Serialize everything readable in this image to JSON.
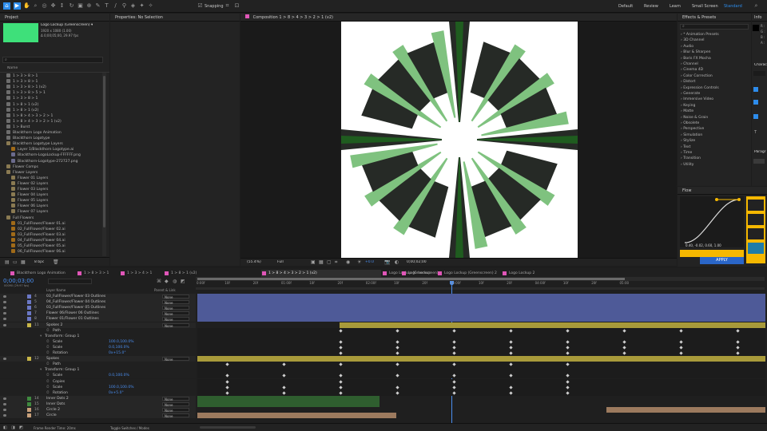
{
  "toolbar": {
    "snapping_label": "Snapping",
    "workspaces": [
      "Default",
      "Review",
      "Learn",
      "Small Screen",
      "Standard"
    ],
    "active_workspace": "Standard",
    "accent": "#2d8ceb"
  },
  "project": {
    "title": "Project",
    "thumb_color": "#3ee07a",
    "item_name": "Logo Lockup (Greenscreen) ▾",
    "item_info_1": "1920 x 1080 (1.00)",
    "item_info_2": "Δ 0;00;05;00, 29.97 fps",
    "search_placeholder": "",
    "column_name": "Name",
    "items": [
      {
        "name": "1 > 3 > 8 > 1",
        "type": "comp"
      },
      {
        "name": "1 > 3 > 8 > 1",
        "type": "comp"
      },
      {
        "name": "1 > 3 > 8 > 1 (v2)",
        "type": "comp"
      },
      {
        "name": "1 > 3 > 8 > 5 > 1",
        "type": "comp"
      },
      {
        "name": "1 > 3 > 8 > 1",
        "type": "comp"
      },
      {
        "name": "1 > 8 > 1 (v2)",
        "type": "comp"
      },
      {
        "name": "1 > 8 > 1 (v2)",
        "type": "comp"
      },
      {
        "name": "1 > 8 > 4 > 3 > 2 > 1",
        "type": "comp"
      },
      {
        "name": "1 > 8 > 4 > 3 > 2 > 1 (v2)",
        "type": "comp"
      },
      {
        "name": "1 > Burst",
        "type": "comp"
      },
      {
        "name": "Blackthorn Logo Animation",
        "type": "comp"
      },
      {
        "name": "Blackthorn Logotype",
        "type": "comp"
      },
      {
        "name": "Blackthorn Logotype Layers",
        "type": "folder"
      },
      {
        "name": "Layer 1/Blackthorn Logotype.ai",
        "type": "ai"
      },
      {
        "name": "Blackthorn-LogoLockup-FFFFFF.png",
        "type": "png"
      },
      {
        "name": "Blackthorn-Logotype-272727.png",
        "type": "png"
      },
      {
        "name": "Flower Comps",
        "type": "folder"
      },
      {
        "name": "Flower Layers",
        "type": "folder"
      },
      {
        "name": "Flower 01 Layers",
        "type": "folder"
      },
      {
        "name": "Flower 02 Layers",
        "type": "folder"
      },
      {
        "name": "Flower 03 Layers",
        "type": "folder"
      },
      {
        "name": "Flower 04 Layers",
        "type": "folder"
      },
      {
        "name": "Flower 05 Layers",
        "type": "folder"
      },
      {
        "name": "Flower 06 Layers",
        "type": "folder"
      },
      {
        "name": "Flower 07 Layers",
        "type": "folder"
      },
      {
        "name": "Full Flowers",
        "type": "folder"
      },
      {
        "name": "01_FullFlower/Flower 01.ai",
        "type": "ai"
      },
      {
        "name": "02_FullFlower/Flower 02.ai",
        "type": "ai"
      },
      {
        "name": "03_FullFlower/Flower 03.ai",
        "type": "ai"
      },
      {
        "name": "04_FullFlower/Flower 04.ai",
        "type": "ai"
      },
      {
        "name": "05_FullFlower/Flower 05.ai",
        "type": "ai"
      },
      {
        "name": "06_FullFlower/Flower 06.ai",
        "type": "ai"
      }
    ],
    "bpc_label": "8 bpc"
  },
  "properties": {
    "title": "Properties: No Selection"
  },
  "composition": {
    "title": "Composition 1 > 8 > 4 > 3 > 2 > 1 (v2)",
    "zoom": "(55.4%)",
    "resolution": "Full",
    "exposure": "+0.0",
    "timecode": "0;00;02;00",
    "colors": {
      "dark": "#262a26",
      "light_green": "#7fc27f",
      "dark_green": "#1f5c1f",
      "canvas": "#ffffff"
    }
  },
  "effects": {
    "title": "Effects & Presets",
    "search_placeholder": "",
    "items": [
      "* Animation Presets",
      "3D Channel",
      "Audio",
      "Blur & Sharpen",
      "Boris FX Mocha",
      "Channel",
      "Cinema 4D",
      "Color Correction",
      "Distort",
      "Expression Controls",
      "Generate",
      "Immersive Video",
      "Keying",
      "Matte",
      "Noise & Grain",
      "Obsolete",
      "Perspective",
      "Simulation",
      "Stylize",
      "Text",
      "Time",
      "Transition",
      "Utility"
    ]
  },
  "info": {
    "title": "Info",
    "r": "R :",
    "g": "G :",
    "b": "B :",
    "a": "A :"
  },
  "flow": {
    "title": "Flow",
    "curve_values": "0.40, -0.02, 0.60, 1.00",
    "apply_label": "APPLY",
    "accent": "#f6b800",
    "apply_color": "#2a66c8"
  },
  "character": {
    "title": "Charac",
    "paragraph": "Paragr"
  },
  "timeline": {
    "tabs": [
      {
        "label": "Blackthorn Logo Animation",
        "active": false
      },
      {
        "label": "1 > 8 > 3 > 1",
        "active": false
      },
      {
        "label": "1 > 3 > 4 > 1",
        "active": false
      },
      {
        "label": "1 > 8 > 1 (v2)",
        "active": false
      },
      {
        "label": "1 > 8 > 4 > 3 > 2 > 1 (v2)",
        "active": true
      },
      {
        "label": "Logo Lockup (Greenscreen)",
        "active": false
      },
      {
        "label": "Logo Lockup",
        "active": false
      },
      {
        "label": "Logo Lockup (Greenscreen) 2",
        "active": false
      },
      {
        "label": "Logo Lockup 2",
        "active": false
      }
    ],
    "timecode": "0;00;03;00",
    "timecode_sub": "00090 (29.97 fps)",
    "col_layer": "Layer Name",
    "col_parent": "Parent & Link",
    "ruler": [
      "0:00f",
      "10f",
      "20f",
      "01:00f",
      "10f",
      "20f",
      "02:00f",
      "10f",
      "20f",
      "03:00f",
      "10f",
      "20f",
      "04:00f",
      "10f",
      "20f",
      "05:00"
    ],
    "layers": [
      {
        "num": "4",
        "name": "03_FullFlower/Flower 03 Outlines",
        "label": "#6b78c6",
        "parent": "None",
        "kind": "layer"
      },
      {
        "num": "5",
        "name": "04_FullFlower/Flower 04 Outlines",
        "label": "#6b78c6",
        "parent": "None",
        "kind": "layer"
      },
      {
        "num": "6",
        "name": "03_FullFlower/Flower 05 Outlines",
        "label": "#6b78c6",
        "parent": "None",
        "kind": "layer"
      },
      {
        "num": "7",
        "name": "Flower 06/Flower 06 Outlines",
        "label": "#6b78c6",
        "parent": "None",
        "kind": "layer"
      },
      {
        "num": "8",
        "name": "Flower 01/Flower 01 Outlines",
        "label": "#6b78c6",
        "parent": "None",
        "kind": "layer"
      },
      {
        "num": "11",
        "name": "Spokes 2",
        "label": "#c9b748",
        "parent": "None",
        "kind": "layer"
      },
      {
        "num": "",
        "name": "Path",
        "label": "",
        "parent": "",
        "kind": "prop"
      },
      {
        "num": "",
        "name": "Transform: Group 1",
        "label": "",
        "parent": "",
        "kind": "group"
      },
      {
        "num": "",
        "name": "Scale",
        "value": "100.0,100.0%",
        "label": "",
        "parent": "",
        "kind": "prop"
      },
      {
        "num": "",
        "name": "Scale",
        "value": "0.0,100.0%",
        "label": "",
        "parent": "",
        "kind": "prop"
      },
      {
        "num": "",
        "name": "Rotation",
        "value": "0x+15.0°",
        "label": "",
        "parent": "",
        "kind": "prop"
      },
      {
        "num": "12",
        "name": "Spokes",
        "label": "#c9b748",
        "parent": "None",
        "kind": "layer"
      },
      {
        "num": "",
        "name": "Path",
        "label": "",
        "parent": "",
        "kind": "prop"
      },
      {
        "num": "",
        "name": "Transform: Group 1",
        "label": "",
        "parent": "",
        "kind": "group"
      },
      {
        "num": "",
        "name": "Scale",
        "value": "0.0,100.0%",
        "label": "",
        "parent": "",
        "kind": "prop"
      },
      {
        "num": "",
        "name": "Copies",
        "value": "",
        "label": "",
        "parent": "",
        "kind": "prop"
      },
      {
        "num": "",
        "name": "Scale",
        "value": "100.0,100.0%",
        "label": "",
        "parent": "",
        "kind": "prop"
      },
      {
        "num": "",
        "name": "Rotation",
        "value": "0x+5.0°",
        "label": "",
        "parent": "",
        "kind": "prop"
      },
      {
        "num": "14",
        "name": "Inner Dots 2",
        "label": "#3f8a3f",
        "parent": "None",
        "kind": "layer"
      },
      {
        "num": "15",
        "name": "Inner Dots",
        "label": "#3f8a3f",
        "parent": "None",
        "kind": "layer"
      },
      {
        "num": "16",
        "name": "Circle 2",
        "label": "#c9a07a",
        "parent": "None",
        "kind": "layer"
      },
      {
        "num": "17",
        "name": "Circle",
        "label": "#c9a07a",
        "parent": "None",
        "kind": "layer"
      }
    ],
    "footer_render": "Frame Render Time: 20ms",
    "footer_toggle": "Toggle Switches / Modes"
  }
}
